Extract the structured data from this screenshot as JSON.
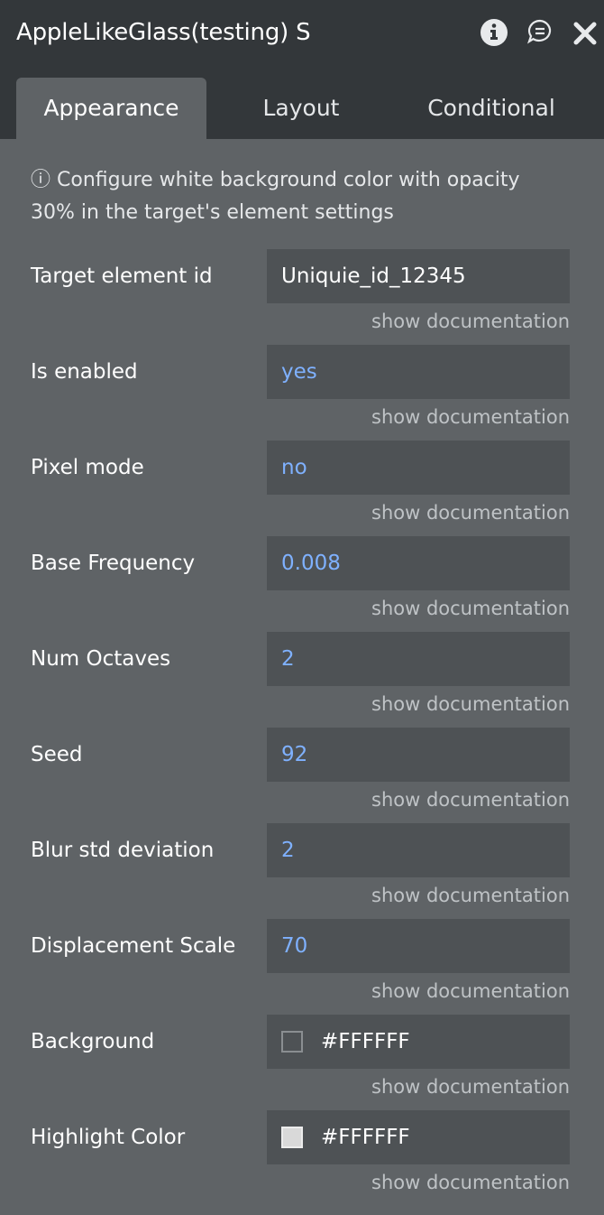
{
  "header": {
    "title": "AppleLikeGlass(testing) S",
    "icons": [
      "info-icon",
      "comment-icon",
      "close-icon"
    ]
  },
  "tabs": [
    {
      "label": "Appearance",
      "active": true
    },
    {
      "label": "Layout",
      "active": false
    },
    {
      "label": "Conditional",
      "active": false
    }
  ],
  "info_text": "ⓘ Configure white background color with opacity 30% in the target's element settings",
  "doc_link": "show documentation",
  "fields": [
    {
      "label": "Target element id",
      "value": "Uniquie_id_12345"
    },
    {
      "label": "Is enabled",
      "value": "yes"
    },
    {
      "label": "Pixel mode",
      "value": "no"
    },
    {
      "label": "Base Frequency",
      "value": "0.008"
    },
    {
      "label": "Num Octaves",
      "value": "2"
    },
    {
      "label": "Seed",
      "value": "92"
    },
    {
      "label": "Blur std deviation",
      "value": "2"
    },
    {
      "label": "Displacement Scale",
      "value": "70"
    },
    {
      "label": "Background",
      "value": "#FFFFFF"
    },
    {
      "label": "Highlight Color",
      "value": "#FFFFFF"
    }
  ],
  "colors": {
    "panel_bg": "#5f6366",
    "header_bg": "#33373a",
    "field_bg": "#4e5255",
    "value_blue": "#7fb1ff"
  }
}
